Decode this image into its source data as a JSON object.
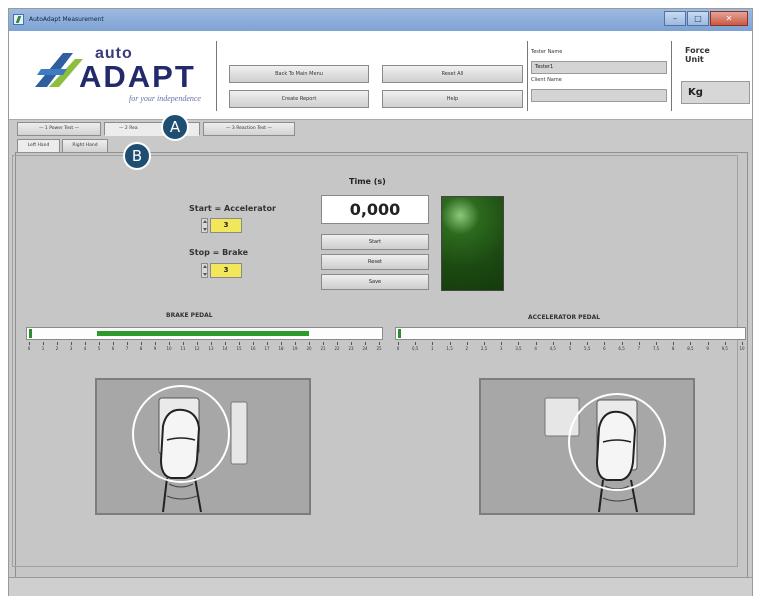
{
  "window": {
    "title": "AutoAdapt Measurement"
  },
  "logo": {
    "auto": "auto",
    "adapt": "ADAPT",
    "tagline": "for your independence"
  },
  "toolbar": {
    "back_label": "Back To Main Menu",
    "reset_all_label": "Reset All",
    "create_report_label": "Create Report",
    "help_label": "Help"
  },
  "fields": {
    "tester_name_label": "Tester Name",
    "tester_name_value": "Tester1",
    "client_name_label": "Client Name",
    "client_name_value": ""
  },
  "force_unit": {
    "label_line1": "Force",
    "label_line2": "Unit",
    "value": "Kg"
  },
  "tabs": [
    {
      "label": "— 1 Power Test —"
    },
    {
      "label": "— 2 Rea"
    },
    {
      "label": "— 3 Reaction Test —"
    }
  ],
  "subtabs": [
    {
      "label": "Left Hand"
    },
    {
      "label": "Right Hand"
    }
  ],
  "callouts": {
    "a": "A",
    "b": "B"
  },
  "controls": {
    "start_label": "Start = Accelerator",
    "start_value": "3",
    "stop_label": "Stop = Brake",
    "stop_value": "3"
  },
  "timer": {
    "label": "Time (s)",
    "value": "0,000",
    "start_btn": "Start",
    "reset_btn": "Reset",
    "save_btn": "Save"
  },
  "brake": {
    "title": "BRAKE PEDAL",
    "fill_fraction": 0.79,
    "ticks": [
      "0",
      "1",
      "2",
      "3",
      "4",
      "5",
      "6",
      "7",
      "8",
      "9",
      "10",
      "11",
      "12",
      "13",
      "14",
      "15",
      "16",
      "17",
      "18",
      "19",
      "20",
      "21",
      "22",
      "23",
      "24",
      "25"
    ]
  },
  "accelerator": {
    "title": "ACCELERATOR PEDAL",
    "fill_fraction": 0.0,
    "ticks": [
      "0",
      "0,5",
      "1",
      "1,5",
      "2",
      "2,5",
      "3",
      "3,5",
      "4",
      "4,5",
      "5",
      "5,5",
      "6",
      "6,5",
      "7",
      "7,5",
      "8",
      "8,5",
      "9",
      "9,5",
      "10"
    ]
  },
  "colors": {
    "accent_green": "#2b9b2b",
    "value_yellow": "#f2e65a",
    "callout_blue": "#1f4e73"
  }
}
